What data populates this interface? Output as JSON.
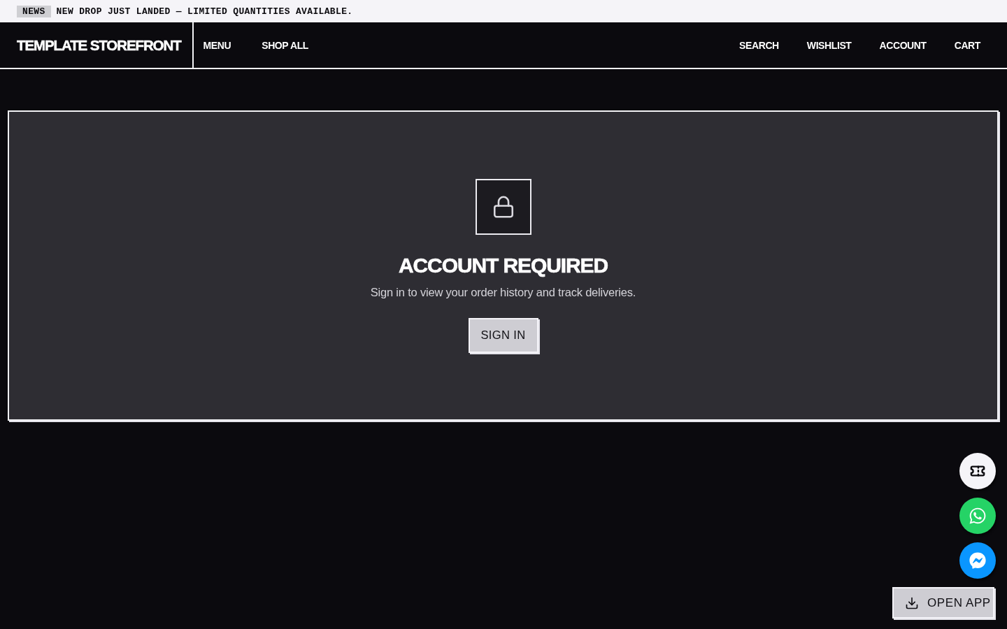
{
  "announcement": {
    "badge": "NEWS",
    "text": "NEW DROP JUST LANDED — LIMITED QUANTITIES AVAILABLE."
  },
  "header": {
    "logo": "TEMPLATE STOREFRONT",
    "nav_left": [
      "MENU",
      "SHOP ALL"
    ],
    "nav_right": [
      "SEARCH",
      "WISHLIST",
      "ACCOUNT",
      "CART"
    ]
  },
  "notice": {
    "title": "ACCOUNT REQUIRED",
    "message": "Sign in to view your order history and track deliveries.",
    "button": "SIGN IN"
  },
  "floating_buttons": [
    {
      "kind": "coupon"
    },
    {
      "kind": "whatsapp"
    },
    {
      "kind": "messenger"
    }
  ],
  "app_button": {
    "label": "OPEN APP"
  }
}
